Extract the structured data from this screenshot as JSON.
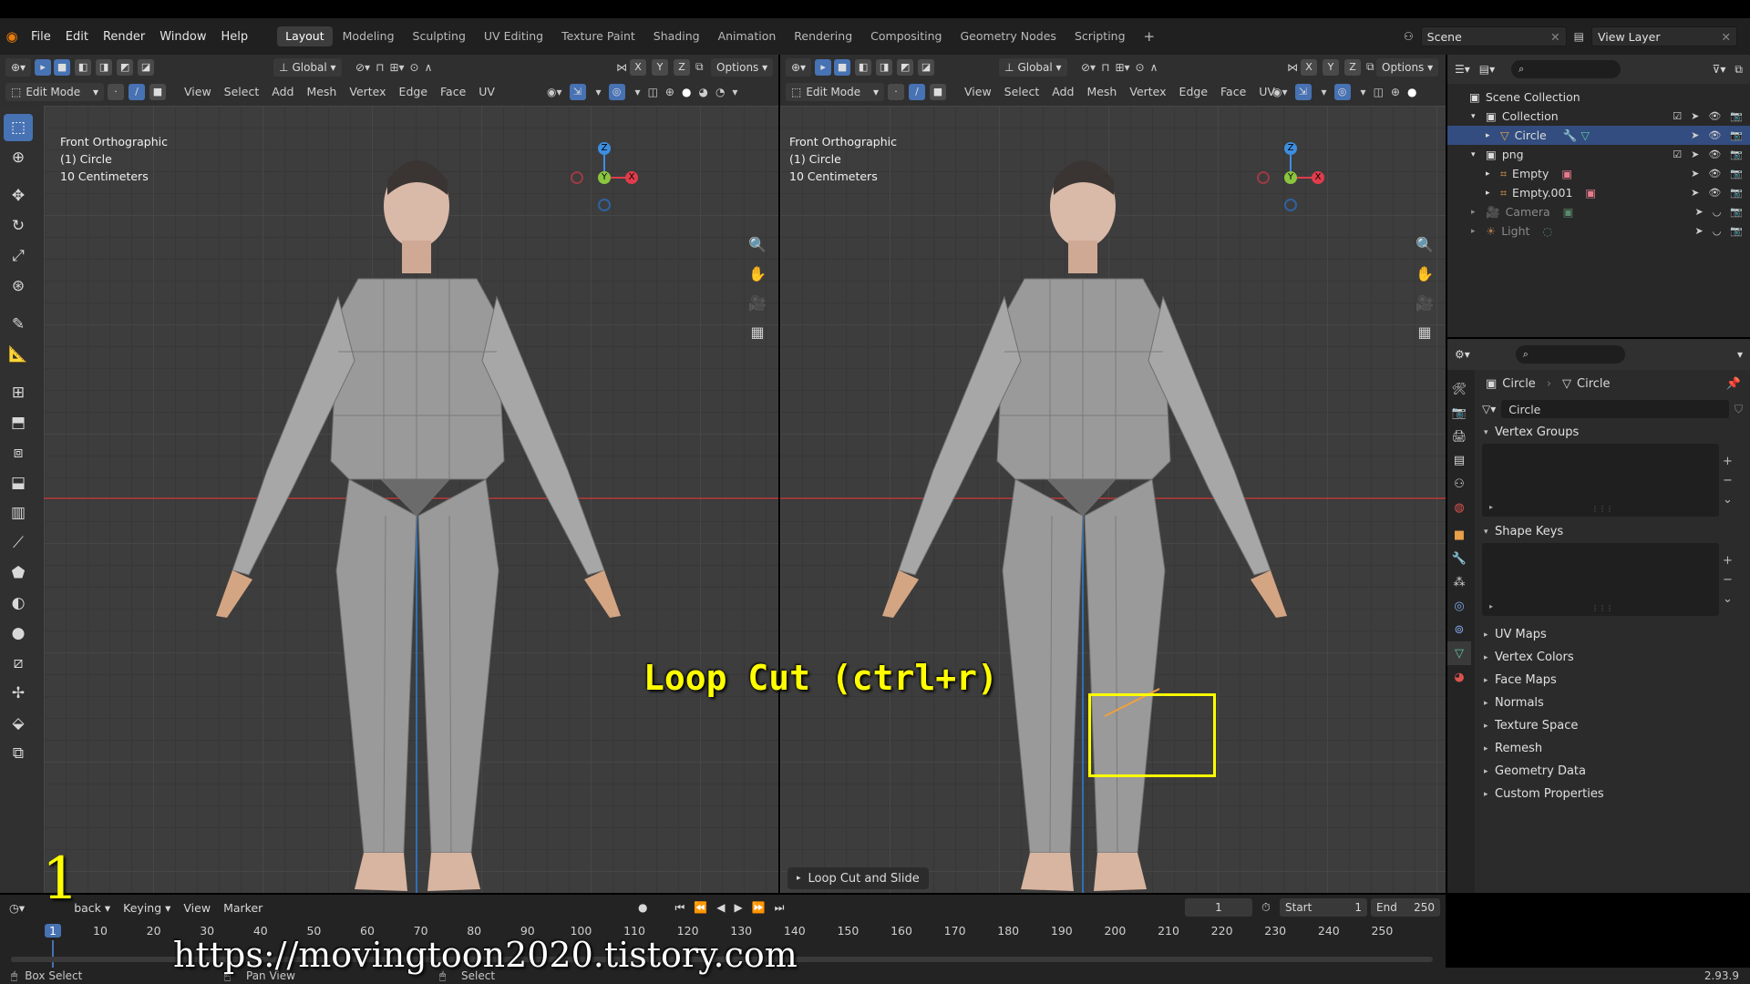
{
  "menu": {
    "file": "File",
    "edit": "Edit",
    "render": "Render",
    "window": "Window",
    "help": "Help"
  },
  "workspaces": [
    "Layout",
    "Modeling",
    "Sculpting",
    "UV Editing",
    "Texture Paint",
    "Shading",
    "Animation",
    "Rendering",
    "Compositing",
    "Geometry Nodes",
    "Scripting"
  ],
  "active_workspace": "Layout",
  "scene": {
    "scene_name": "Scene",
    "view_layer": "View Layer"
  },
  "viewport_header": {
    "mode": "Edit Mode",
    "orientation": "Global",
    "options": "Options",
    "menus": [
      "View",
      "Select",
      "Add",
      "Mesh",
      "Vertex",
      "Edge",
      "Face",
      "UV"
    ],
    "axes": [
      "X",
      "Y",
      "Z"
    ]
  },
  "viewport_left": {
    "info1": "Front Orthographic",
    "info2": "(1) Circle",
    "info3": "10 Centimeters"
  },
  "viewport_right": {
    "info1": "Front Orthographic",
    "info2": "(1) Circle",
    "info3": "10 Centimeters",
    "op_panel": "Loop Cut and Slide"
  },
  "gizmo": {
    "z": "Z",
    "y": "Y",
    "x": "X"
  },
  "overlay": {
    "caption": "Loop Cut (ctrl+r)",
    "step": "1",
    "url": "https://movingtoon2020.tistory.com"
  },
  "outliner": {
    "root": "Scene Collection",
    "items": [
      {
        "label": "Collection",
        "indent": 1
      },
      {
        "label": "Circle",
        "indent": 2,
        "selected": true
      },
      {
        "label": "png",
        "indent": 1
      },
      {
        "label": "Empty",
        "indent": 2
      },
      {
        "label": "Empty.001",
        "indent": 2
      },
      {
        "label": "Camera",
        "indent": 1,
        "dim": true
      },
      {
        "label": "Light",
        "indent": 1,
        "dim": true
      }
    ]
  },
  "properties": {
    "crumb_object": "Circle",
    "crumb_data": "Circle",
    "data_name": "Circle",
    "sections": {
      "vertex_groups": "Vertex Groups",
      "shape_keys": "Shape Keys",
      "uv_maps": "UV Maps",
      "vertex_colors": "Vertex Colors",
      "face_maps": "Face Maps",
      "normals": "Normals",
      "texture_space": "Texture Space",
      "remesh": "Remesh",
      "geometry_data": "Geometry Data",
      "custom_properties": "Custom Properties"
    }
  },
  "timeline": {
    "playback": "back",
    "keying": "Keying",
    "view": "View",
    "marker": "Marker",
    "current_frame": "1",
    "start_label": "Start",
    "start": "1",
    "end_label": "End",
    "end": "250",
    "ticks": [
      "1",
      "10",
      "20",
      "30",
      "40",
      "50",
      "60",
      "70",
      "80",
      "90",
      "100",
      "110",
      "120",
      "130",
      "140",
      "150",
      "160",
      "170",
      "180",
      "190",
      "200",
      "210",
      "220",
      "230",
      "240",
      "250"
    ]
  },
  "statusbar": {
    "left": "Box Select",
    "mid1": "Pan View",
    "mid2": "Select",
    "version": "2.93.9"
  },
  "colors": {
    "accent": "#4772b3",
    "caption": "#ffff00",
    "x_axis": "#e03c4c",
    "y_axis": "#8bc53f",
    "z_axis": "#3d8ee0"
  }
}
